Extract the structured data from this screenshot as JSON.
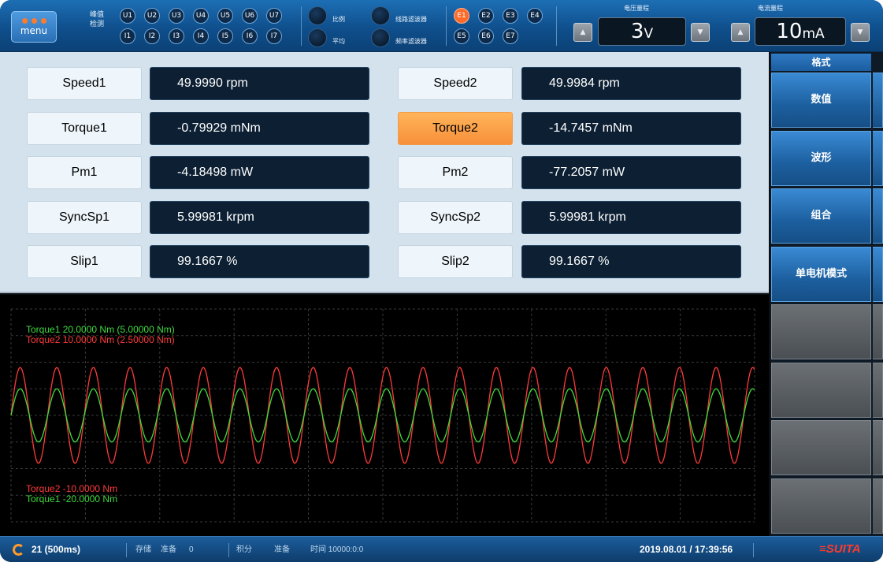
{
  "topbar": {
    "menu_label": "menu",
    "peak_detect_label": "峰值\n检测",
    "u_channels": [
      "U1",
      "U2",
      "U3",
      "U4",
      "U5",
      "U6",
      "U7"
    ],
    "i_channels": [
      "I1",
      "I2",
      "I3",
      "I4",
      "I5",
      "I6",
      "I7"
    ],
    "ratio_label": "比例",
    "average_label": "平均",
    "line_filter_label": "线路滤波器",
    "freq_filter_label": "频率滤波器",
    "e_channels_top": [
      "E1",
      "E2",
      "E3",
      "E4"
    ],
    "e_channels_bottom": [
      "E5",
      "E6",
      "E7"
    ],
    "active_channel": "E1",
    "voltage_range_title": "电压量程",
    "voltage_range_value": "3",
    "voltage_range_unit": "V",
    "current_range_title": "电流量程",
    "current_range_value": "10",
    "current_range_unit": "mA",
    "up_arrow": "▲",
    "down_arrow": "▼"
  },
  "measurements": {
    "left": [
      {
        "label": "Speed1",
        "value": "49.9990 rpm"
      },
      {
        "label": "Torque1",
        "value": "-0.79929 mNm"
      },
      {
        "label": "Pm1",
        "value": "-4.18498 mW"
      },
      {
        "label": "SyncSp1",
        "value": "5.99981 krpm"
      },
      {
        "label": "Slip1",
        "value": "99.1667  %"
      }
    ],
    "right": [
      {
        "label": "Speed2",
        "value": "49.9984 rpm"
      },
      {
        "label": "Torque2",
        "value": "-14.7457 mNm",
        "highlighted": true
      },
      {
        "label": "Pm2",
        "value": "-77.2057 mW"
      },
      {
        "label": "SyncSp2",
        "value": "5.99981 krpm"
      },
      {
        "label": "Slip2",
        "value": "99.1667  %"
      }
    ]
  },
  "right_menu": {
    "header": "格式",
    "buttons": [
      "数值",
      "波形",
      "组合",
      "单电机模式"
    ]
  },
  "scope": {
    "top_labels": [
      {
        "text": "Torque1  20.0000 Nm (5.00000 Nm)",
        "color": "#3ddc3d"
      },
      {
        "text": "Torque2  10.0000 Nm (2.50000 Nm)",
        "color": "#ff3a3a"
      }
    ],
    "bottom_labels": [
      {
        "text": "Torque2  -10.0000 Nm",
        "color": "#ff3a3a"
      },
      {
        "text": "Torque1  -20.0000 Nm",
        "color": "#3ddc3d"
      }
    ],
    "cycles": 20.3,
    "torque1_amplitude_fraction": 0.25,
    "torque2_amplitude_fraction": 0.45
  },
  "status": {
    "count_label": "21 (500ms)",
    "storage_label": "存储",
    "storage_state": "准备",
    "storage_count": "0",
    "integration_label": "积分",
    "integration_state": "准备",
    "time_label": "时间 10000:0:0",
    "datetime": "2019.08.01 / 17:39:56",
    "logo": "≡SUITA"
  }
}
